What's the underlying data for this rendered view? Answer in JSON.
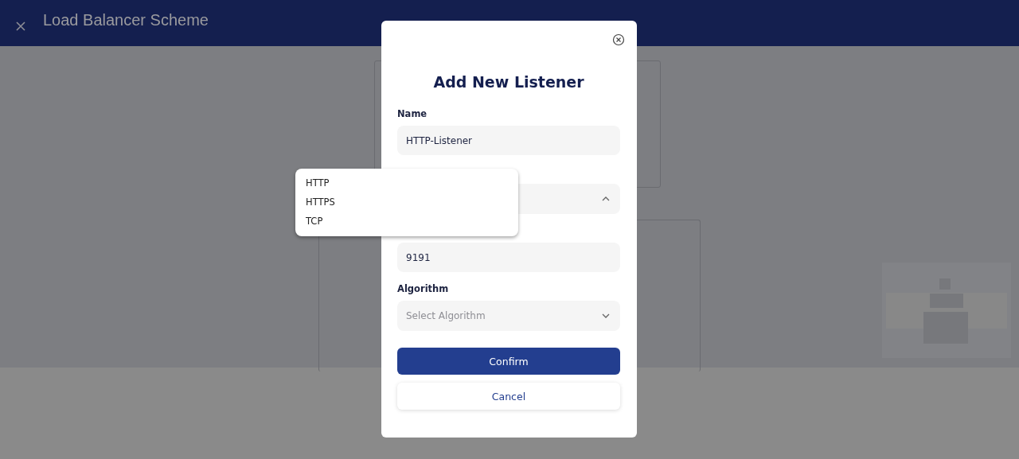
{
  "header": {
    "title": "Load Balancer Scheme"
  },
  "dialog": {
    "title": "Add New Listener",
    "fields": [
      {
        "kind": "text",
        "label": "Name",
        "value": "HTTP-Listener"
      },
      {
        "kind": "select",
        "expanded": true,
        "options": [
          "HTTP",
          "HTTPS",
          "TCP"
        ]
      },
      {
        "kind": "text",
        "value": "9191"
      },
      {
        "kind": "select",
        "label": "Algorithm",
        "placeholder": "Select Algorithm",
        "expanded": false
      }
    ],
    "buttons": [
      {
        "kind": "primary",
        "label": "Confirm"
      },
      {
        "kind": "secondary",
        "label": "Cancel"
      }
    ]
  }
}
